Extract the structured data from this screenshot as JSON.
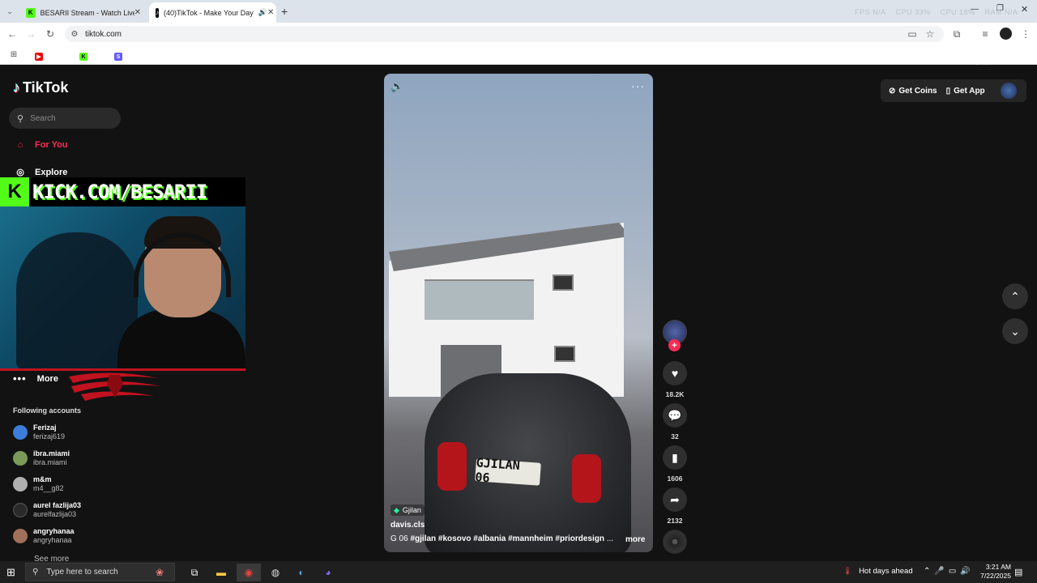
{
  "browser": {
    "tabs": [
      {
        "title": "BESARII Stream - Watch Live on",
        "favicon": "K",
        "active": false
      },
      {
        "title": "(40)TikTok - Make Your Day",
        "favicon": "tiktok",
        "active": true
      }
    ],
    "url": "tiktok.com",
    "bookmarks": [
      {
        "label": "YouTube",
        "icon": "youtube-icon"
      },
      {
        "label": "KICK",
        "icon": "kick-icon"
      },
      {
        "label": "Stripe | Financial Infr...",
        "icon": "stripe-icon"
      }
    ],
    "all_bookmarks": "All Bookmarks",
    "overlay_stats": [
      "FPS N/A",
      "CPU 33%",
      "CPU 18%",
      "RAM N/A"
    ]
  },
  "tiktok": {
    "logo_text": "TikTok",
    "search_placeholder": "Search",
    "nav": {
      "for_you": "For You",
      "explore": "Explore",
      "more": "More"
    },
    "following_title": "Following accounts",
    "following": [
      {
        "name": "Ferizaj",
        "handle": "ferizaj619",
        "color": "#3b7dd8"
      },
      {
        "name": "ibra.miami",
        "handle": "ibra.miami",
        "color": "#7a9a5a"
      },
      {
        "name": "m&m",
        "handle": "m4__g82",
        "color": "#b0b0b0"
      },
      {
        "name": "aurel fazlija03",
        "handle": "aurelfazlija03",
        "color": "#2a2a2a"
      },
      {
        "name": "angryhanaa",
        "handle": "angryhanaa",
        "color": "#a0705a"
      }
    ],
    "see_more": "See more",
    "top_right": {
      "get_coins": "Get Coins",
      "get_app": "Get App"
    },
    "video": {
      "location": "Gjilan",
      "author": "davis.cls",
      "caption_prefix": "G 06",
      "hashtags": "#gjilan #kosovo #albania #mannheim #priordesign",
      "ellipsis": "...",
      "more": "more",
      "plate": "GJILAN 06",
      "likes": "18.2K",
      "comments": "32",
      "saves": "1606",
      "shares": "2132"
    }
  },
  "stream_overlay": {
    "kick_text": "KICK.COM/BESARII"
  },
  "taskbar": {
    "search_placeholder": "Type here to search",
    "weather": "Hot days ahead",
    "time": "3:21 AM",
    "date": "7/22/2025"
  }
}
